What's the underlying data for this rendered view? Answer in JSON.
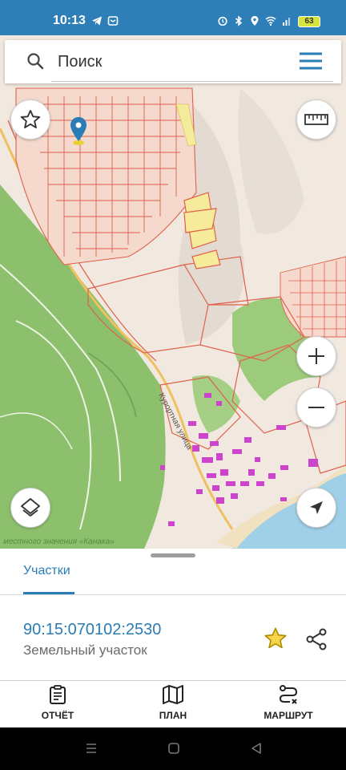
{
  "status_bar": {
    "time": "10:13",
    "battery": "63",
    "left_icons": [
      "telegram-icon",
      "app-icon"
    ],
    "right_icons": [
      "alarm-icon",
      "bluetooth-icon",
      "location-icon",
      "wifi-icon",
      "signal-icon"
    ]
  },
  "search": {
    "placeholder": "Поиск"
  },
  "map": {
    "street_label": "Курортная улица",
    "area_label": "местного значения «Канака»",
    "colors": {
      "parcel_outline": "#e0604a",
      "forest": "#8cc06c",
      "sea": "#9fd0e8",
      "building": "#cc44cc",
      "road": "#f0c060"
    }
  },
  "sheet": {
    "tab_label": "Участки",
    "cadastral_number": "90:15:070102:2530",
    "parcel_type": "Земельный участок",
    "accent_color": "#2a7cb6",
    "star_color": "#e6b800"
  },
  "bottom_nav": [
    {
      "label": "ОТЧЁТ",
      "icon": "report-icon"
    },
    {
      "label": "ПЛАН",
      "icon": "map-plan-icon"
    },
    {
      "label": "МАРШРУТ",
      "icon": "route-icon"
    }
  ]
}
